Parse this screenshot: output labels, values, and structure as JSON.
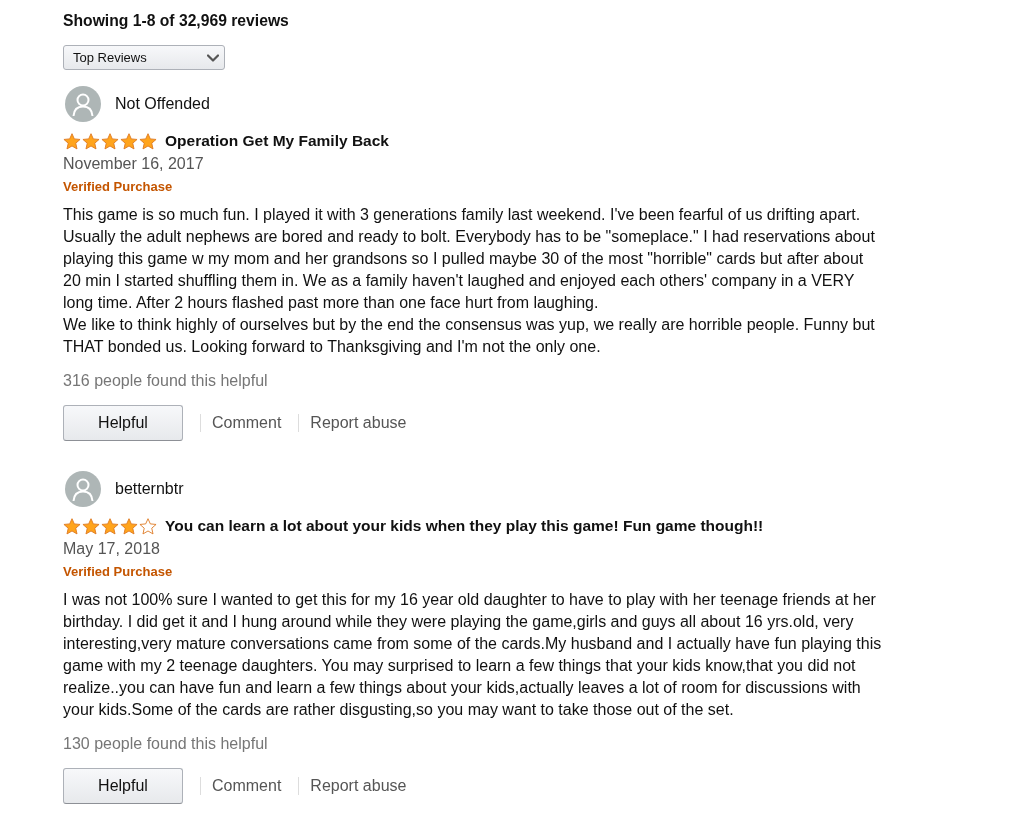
{
  "header": {
    "title": "Showing 1-8 of 32,969 reviews"
  },
  "sort": {
    "value": "Top Reviews"
  },
  "reviews": [
    {
      "author": "Not Offended",
      "stars": 5,
      "title": "Operation Get My Family Back",
      "date": "November 16, 2017",
      "badge": "Verified Purchase",
      "body": "This game is so much fun. I played it with 3 generations family last weekend. I've been fearful of us drifting apart. Usually the adult nephews are bored and ready to bolt. Everybody has to be \"someplace.\" I had reservations about playing this game w my mom and her grandsons so I pulled maybe 30 of the most \"horrible\" cards but after about 20 min I started shuffling them in. We as a family haven't laughed and enjoyed each others' company in a VERY long time. After 2 hours flashed past more than one face hurt from laughing.\nWe like to think highly of ourselves but by the end the consensus was yup, we really are horrible people. Funny but THAT bonded us. Looking forward to Thanksgiving and I'm not the only one.",
      "helpful_count": "316 people found this helpful",
      "actions": [
        {
          "kind": "button",
          "label": "Helpful"
        },
        {
          "kind": "link",
          "label": "Comment"
        },
        {
          "kind": "link",
          "label": "Report abuse"
        }
      ]
    },
    {
      "author": "betternbtr",
      "stars": 4,
      "title": "You can learn a lot about your kids when they play this game! Fun game though!!",
      "date": "May 17, 2018",
      "badge": "Verified Purchase",
      "body": "I was not 100% sure I wanted to get this for my 16 year old daughter to have to play with her teenage friends at her birthday. I did get it and I hung around while they were playing the game,girls and guys all about 16 yrs.old, very interesting,very mature conversations came from some of the cards.My husband and I actually have fun playing this game with my 2 teenage daughters. You may surprised to learn a few things that your kids know,that you did not realize..you can have fun and learn a few things about your kids,actually leaves a lot of room for discussions with your kids.Some of the cards are rather disgusting,so you may want to take those out of the set.",
      "helpful_count": "130 people found this helpful",
      "actions": [
        {
          "kind": "button",
          "label": "Helpful"
        },
        {
          "kind": "link",
          "label": "Comment"
        },
        {
          "kind": "link",
          "label": "Report abuse"
        }
      ]
    }
  ]
}
